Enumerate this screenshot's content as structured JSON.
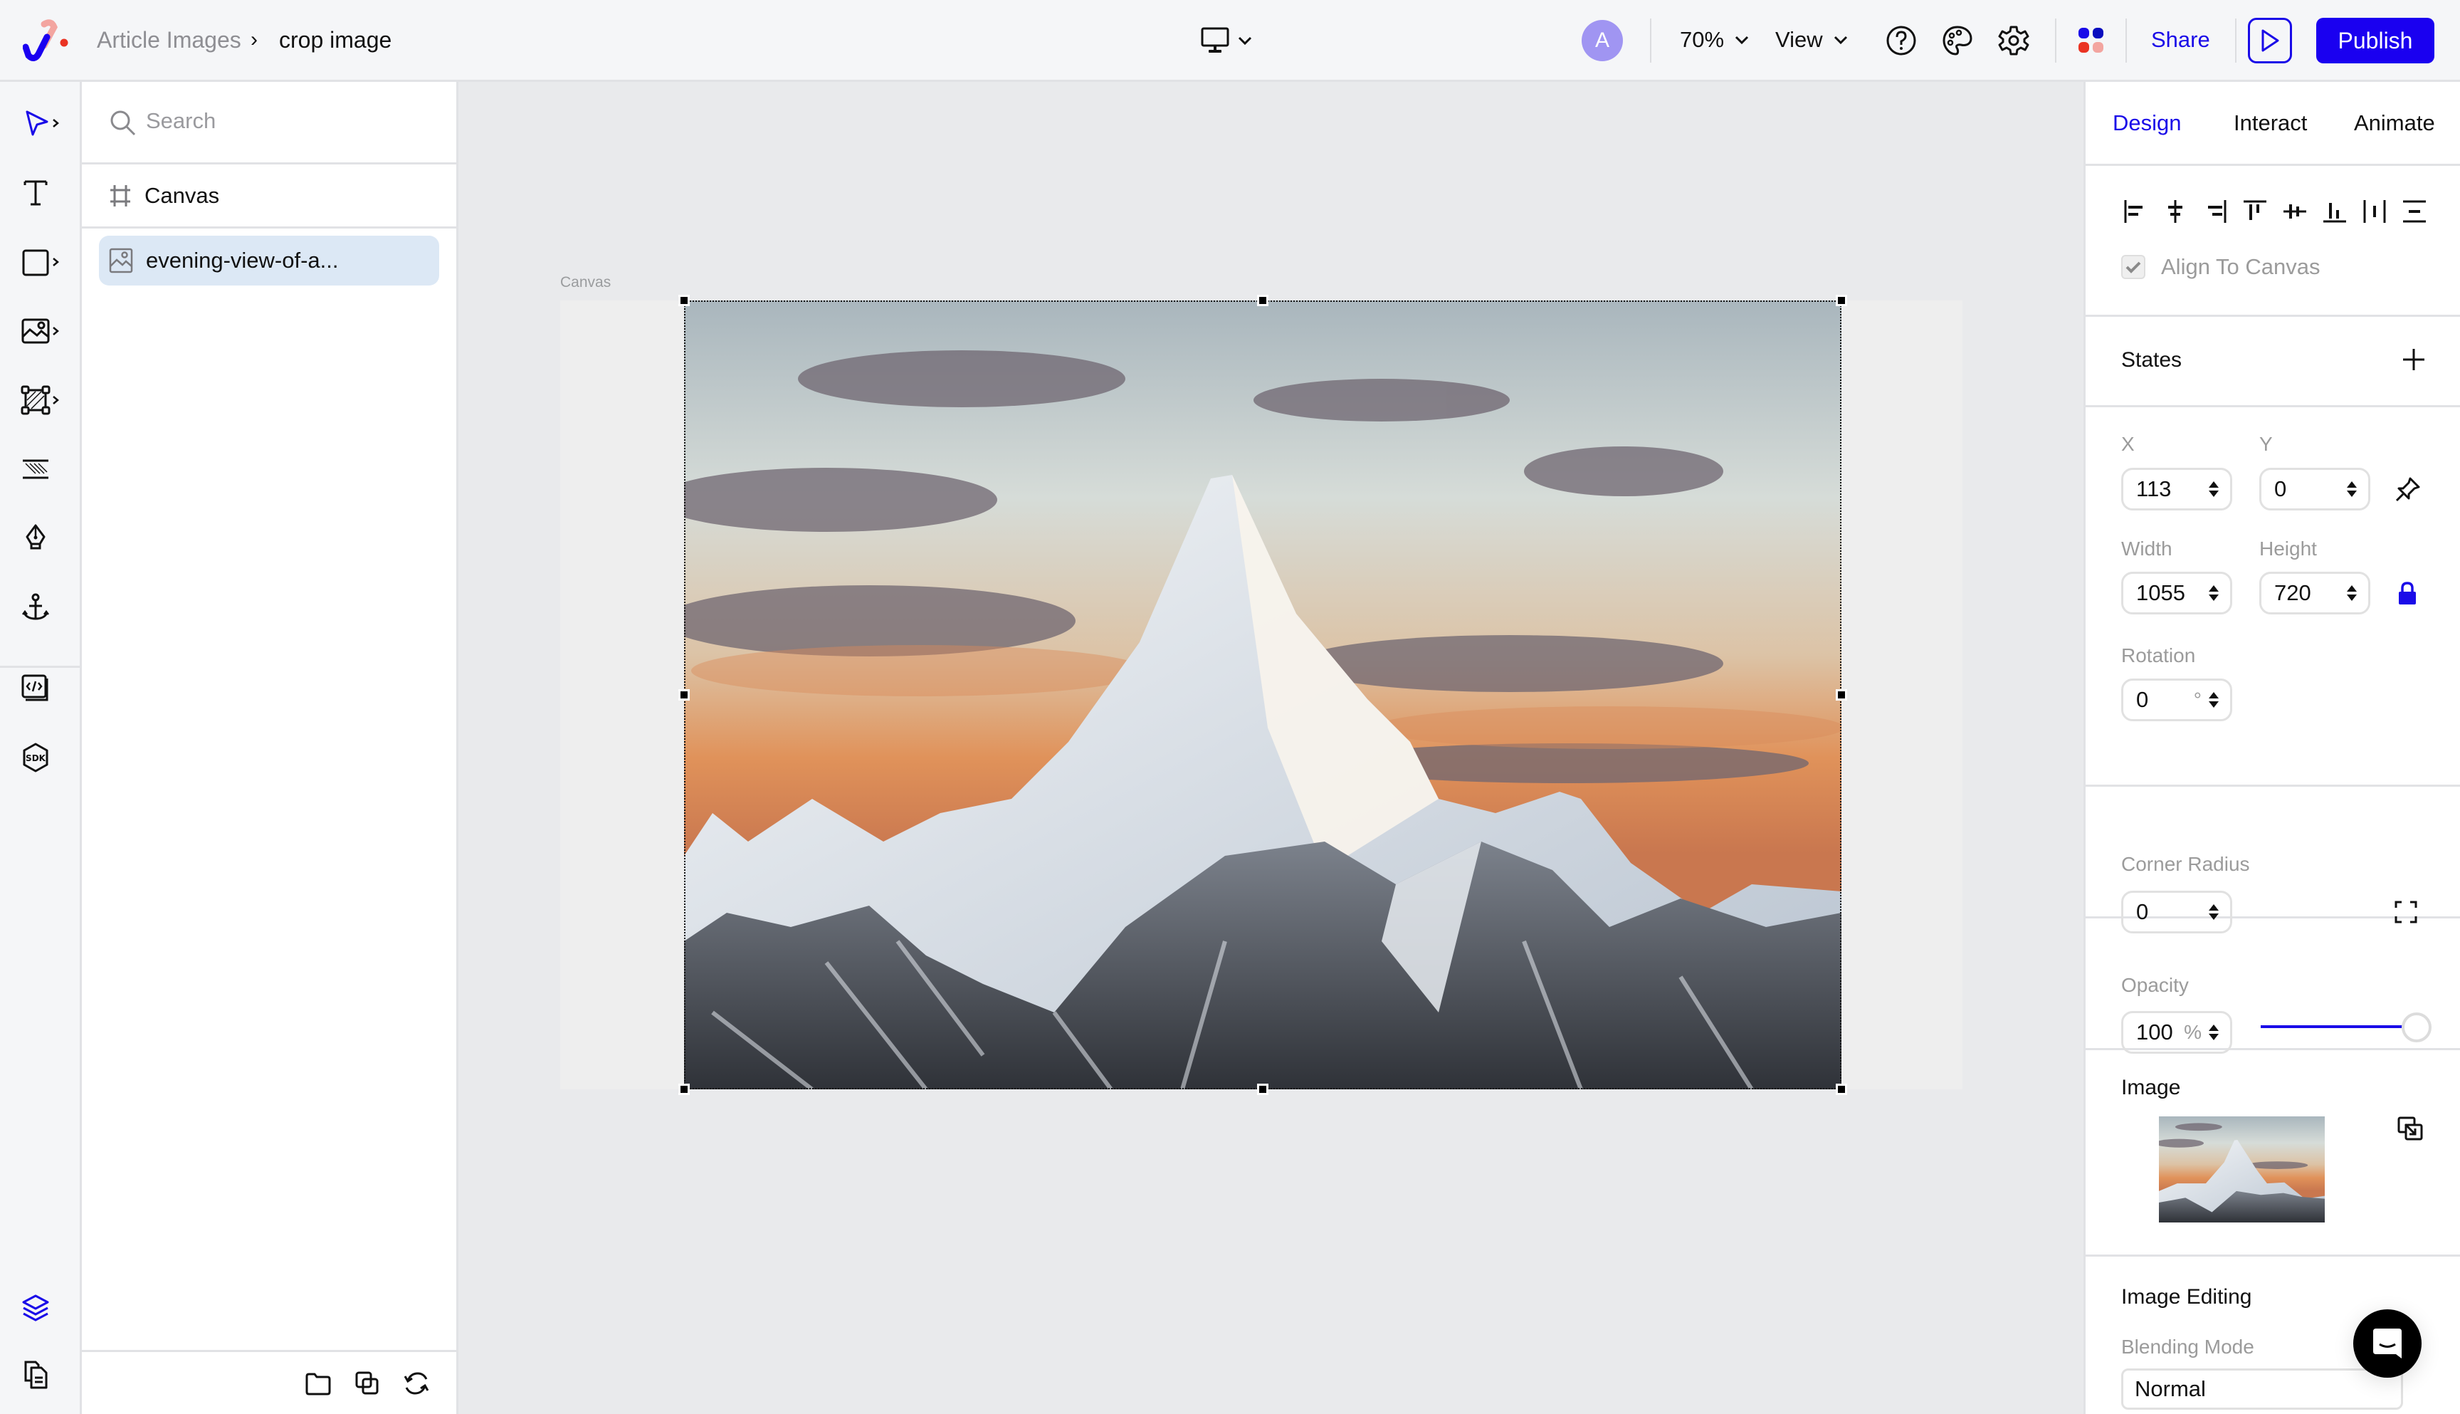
{
  "topbar": {
    "breadcrumb": {
      "parent": "Article Images",
      "separator": "›",
      "current": "crop image"
    },
    "device_icon": "desktop-icon",
    "avatar_initial": "A",
    "zoom": "70%",
    "view_label": "View",
    "share_label": "Share",
    "publish_label": "Publish",
    "colors": {
      "accent": "#1a00f0",
      "avatar": "#a095f2"
    }
  },
  "toolbar": {
    "tools": [
      {
        "name": "select-tool",
        "icon": "cursor-arrow-icon",
        "active": true,
        "has_submenu": true
      },
      {
        "name": "text-tool",
        "icon": "text-icon",
        "has_submenu": false
      },
      {
        "name": "shape-tool",
        "icon": "rectangle-icon",
        "has_submenu": true
      },
      {
        "name": "image-tool",
        "icon": "image-icon",
        "has_submenu": true
      },
      {
        "name": "frame-tool",
        "icon": "frame-icon",
        "has_submenu": true
      },
      {
        "name": "hatch-tool",
        "icon": "hatch-icon",
        "has_submenu": false
      },
      {
        "name": "pen-tool",
        "icon": "pen-nib-icon",
        "has_submenu": false
      },
      {
        "name": "anchor-tool",
        "icon": "anchor-icon",
        "has_submenu": false
      },
      {
        "name": "embed-code-tool",
        "icon": "code-icon",
        "has_submenu": false
      },
      {
        "name": "sdk-tool",
        "icon": "sdk-icon",
        "has_submenu": false
      },
      {
        "name": "layers-tool",
        "icon": "layers-icon",
        "active": true
      },
      {
        "name": "pages-tool",
        "icon": "pages-icon"
      }
    ]
  },
  "layers": {
    "search_placeholder": "Search",
    "items": [
      {
        "label": "Canvas",
        "icon": "frame-grid-icon",
        "selected": false
      },
      {
        "label": "evening-view-of-a...",
        "icon": "image-icon",
        "selected": true
      }
    ],
    "footer_icons": [
      "folder-icon",
      "duplicate-icon",
      "refresh-icon"
    ]
  },
  "canvas": {
    "label": "Canvas",
    "image_name": "evening-view-of-a..."
  },
  "properties": {
    "tabs": [
      {
        "label": "Design",
        "active": true
      },
      {
        "label": "Interact",
        "active": false
      },
      {
        "label": "Animate",
        "active": false
      }
    ],
    "align_to_canvas": {
      "label": "Align To Canvas",
      "checked": true
    },
    "states_label": "States",
    "x": {
      "label": "X",
      "value": "113"
    },
    "y": {
      "label": "Y",
      "value": "0"
    },
    "width": {
      "label": "Width",
      "value": "1055"
    },
    "height": {
      "label": "Height",
      "value": "720"
    },
    "rotation": {
      "label": "Rotation",
      "value": "0",
      "unit": "°"
    },
    "corner_radius": {
      "label": "Corner Radius",
      "value": "0"
    },
    "opacity": {
      "label": "Opacity",
      "value": "100",
      "unit": "%",
      "fraction": 1.0
    },
    "image_section_label": "Image",
    "image_editing_label": "Image Editing",
    "blending_mode": {
      "label": "Blending Mode",
      "value": "Normal"
    }
  }
}
